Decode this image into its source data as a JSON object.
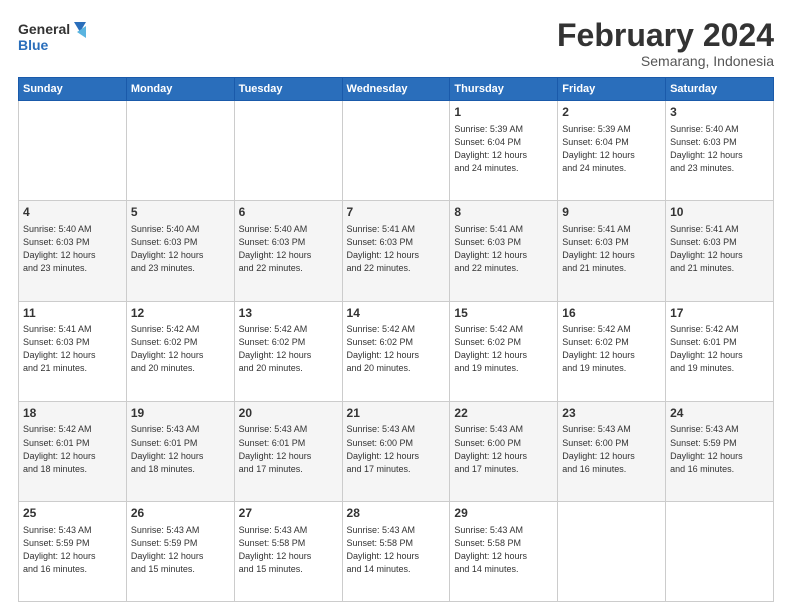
{
  "logo": {
    "line1": "General",
    "line2": "Blue"
  },
  "title": "February 2024",
  "subtitle": "Semarang, Indonesia",
  "days_of_week": [
    "Sunday",
    "Monday",
    "Tuesday",
    "Wednesday",
    "Thursday",
    "Friday",
    "Saturday"
  ],
  "weeks": [
    [
      {
        "day": "",
        "info": ""
      },
      {
        "day": "",
        "info": ""
      },
      {
        "day": "",
        "info": ""
      },
      {
        "day": "",
        "info": ""
      },
      {
        "day": "1",
        "info": "Sunrise: 5:39 AM\nSunset: 6:04 PM\nDaylight: 12 hours\nand 24 minutes."
      },
      {
        "day": "2",
        "info": "Sunrise: 5:39 AM\nSunset: 6:04 PM\nDaylight: 12 hours\nand 24 minutes."
      },
      {
        "day": "3",
        "info": "Sunrise: 5:40 AM\nSunset: 6:03 PM\nDaylight: 12 hours\nand 23 minutes."
      }
    ],
    [
      {
        "day": "4",
        "info": "Sunrise: 5:40 AM\nSunset: 6:03 PM\nDaylight: 12 hours\nand 23 minutes."
      },
      {
        "day": "5",
        "info": "Sunrise: 5:40 AM\nSunset: 6:03 PM\nDaylight: 12 hours\nand 23 minutes."
      },
      {
        "day": "6",
        "info": "Sunrise: 5:40 AM\nSunset: 6:03 PM\nDaylight: 12 hours\nand 22 minutes."
      },
      {
        "day": "7",
        "info": "Sunrise: 5:41 AM\nSunset: 6:03 PM\nDaylight: 12 hours\nand 22 minutes."
      },
      {
        "day": "8",
        "info": "Sunrise: 5:41 AM\nSunset: 6:03 PM\nDaylight: 12 hours\nand 22 minutes."
      },
      {
        "day": "9",
        "info": "Sunrise: 5:41 AM\nSunset: 6:03 PM\nDaylight: 12 hours\nand 21 minutes."
      },
      {
        "day": "10",
        "info": "Sunrise: 5:41 AM\nSunset: 6:03 PM\nDaylight: 12 hours\nand 21 minutes."
      }
    ],
    [
      {
        "day": "11",
        "info": "Sunrise: 5:41 AM\nSunset: 6:03 PM\nDaylight: 12 hours\nand 21 minutes."
      },
      {
        "day": "12",
        "info": "Sunrise: 5:42 AM\nSunset: 6:02 PM\nDaylight: 12 hours\nand 20 minutes."
      },
      {
        "day": "13",
        "info": "Sunrise: 5:42 AM\nSunset: 6:02 PM\nDaylight: 12 hours\nand 20 minutes."
      },
      {
        "day": "14",
        "info": "Sunrise: 5:42 AM\nSunset: 6:02 PM\nDaylight: 12 hours\nand 20 minutes."
      },
      {
        "day": "15",
        "info": "Sunrise: 5:42 AM\nSunset: 6:02 PM\nDaylight: 12 hours\nand 19 minutes."
      },
      {
        "day": "16",
        "info": "Sunrise: 5:42 AM\nSunset: 6:02 PM\nDaylight: 12 hours\nand 19 minutes."
      },
      {
        "day": "17",
        "info": "Sunrise: 5:42 AM\nSunset: 6:01 PM\nDaylight: 12 hours\nand 19 minutes."
      }
    ],
    [
      {
        "day": "18",
        "info": "Sunrise: 5:42 AM\nSunset: 6:01 PM\nDaylight: 12 hours\nand 18 minutes."
      },
      {
        "day": "19",
        "info": "Sunrise: 5:43 AM\nSunset: 6:01 PM\nDaylight: 12 hours\nand 18 minutes."
      },
      {
        "day": "20",
        "info": "Sunrise: 5:43 AM\nSunset: 6:01 PM\nDaylight: 12 hours\nand 17 minutes."
      },
      {
        "day": "21",
        "info": "Sunrise: 5:43 AM\nSunset: 6:00 PM\nDaylight: 12 hours\nand 17 minutes."
      },
      {
        "day": "22",
        "info": "Sunrise: 5:43 AM\nSunset: 6:00 PM\nDaylight: 12 hours\nand 17 minutes."
      },
      {
        "day": "23",
        "info": "Sunrise: 5:43 AM\nSunset: 6:00 PM\nDaylight: 12 hours\nand 16 minutes."
      },
      {
        "day": "24",
        "info": "Sunrise: 5:43 AM\nSunset: 5:59 PM\nDaylight: 12 hours\nand 16 minutes."
      }
    ],
    [
      {
        "day": "25",
        "info": "Sunrise: 5:43 AM\nSunset: 5:59 PM\nDaylight: 12 hours\nand 16 minutes."
      },
      {
        "day": "26",
        "info": "Sunrise: 5:43 AM\nSunset: 5:59 PM\nDaylight: 12 hours\nand 15 minutes."
      },
      {
        "day": "27",
        "info": "Sunrise: 5:43 AM\nSunset: 5:58 PM\nDaylight: 12 hours\nand 15 minutes."
      },
      {
        "day": "28",
        "info": "Sunrise: 5:43 AM\nSunset: 5:58 PM\nDaylight: 12 hours\nand 14 minutes."
      },
      {
        "day": "29",
        "info": "Sunrise: 5:43 AM\nSunset: 5:58 PM\nDaylight: 12 hours\nand 14 minutes."
      },
      {
        "day": "",
        "info": ""
      },
      {
        "day": "",
        "info": ""
      }
    ]
  ]
}
